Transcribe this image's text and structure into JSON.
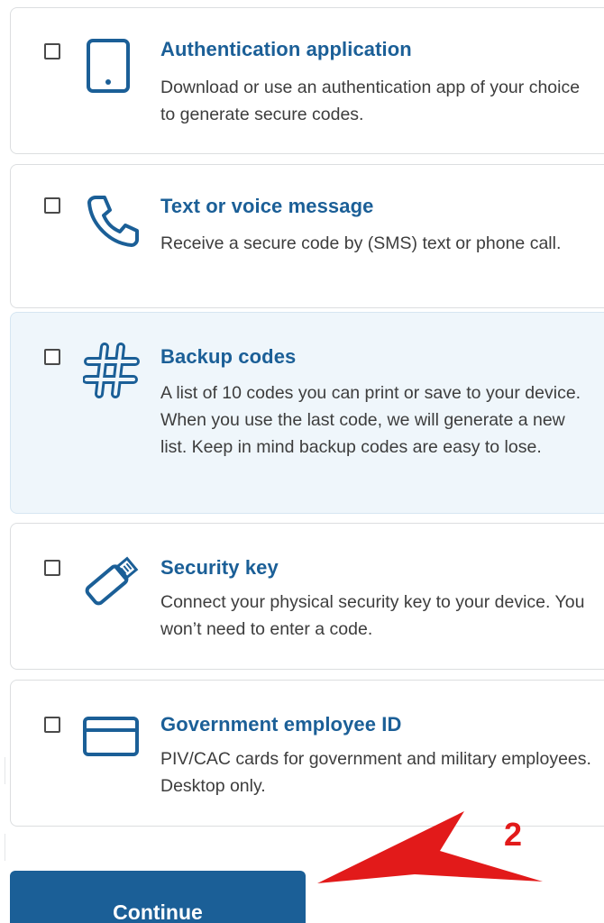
{
  "options": [
    {
      "title": "Authentication application",
      "description": "Download or use an authentication app of your choice to generate secure codes.",
      "icon": "tablet-icon",
      "checked": false
    },
    {
      "title": "Text or voice message",
      "description": "Receive a secure code by (SMS) text or phone call.",
      "icon": "phone-icon",
      "checked": false
    },
    {
      "title": "Backup codes",
      "description": "A list of 10 codes you can print or save to your device. When you use the last code, we will generate a new list. Keep in mind backup codes are easy to lose.",
      "icon": "hashtag-icon",
      "checked": false
    },
    {
      "title": "Security key",
      "description": "Connect your physical security key to your device. You won’t need to enter a code.",
      "icon": "security-key-icon",
      "checked": false
    },
    {
      "title": "Government employee ID",
      "description": "PIV/CAC cards for government and military employees. Desktop only.",
      "icon": "id-card-icon",
      "checked": false
    }
  ],
  "continue_label": "Continue",
  "annotation": {
    "number": "2",
    "color": "#e21a1a"
  },
  "colors": {
    "primary": "#1b5f97",
    "highlight_bg": "#eff6fb",
    "border": "#dcdee0",
    "text": "#3d3d3d"
  }
}
